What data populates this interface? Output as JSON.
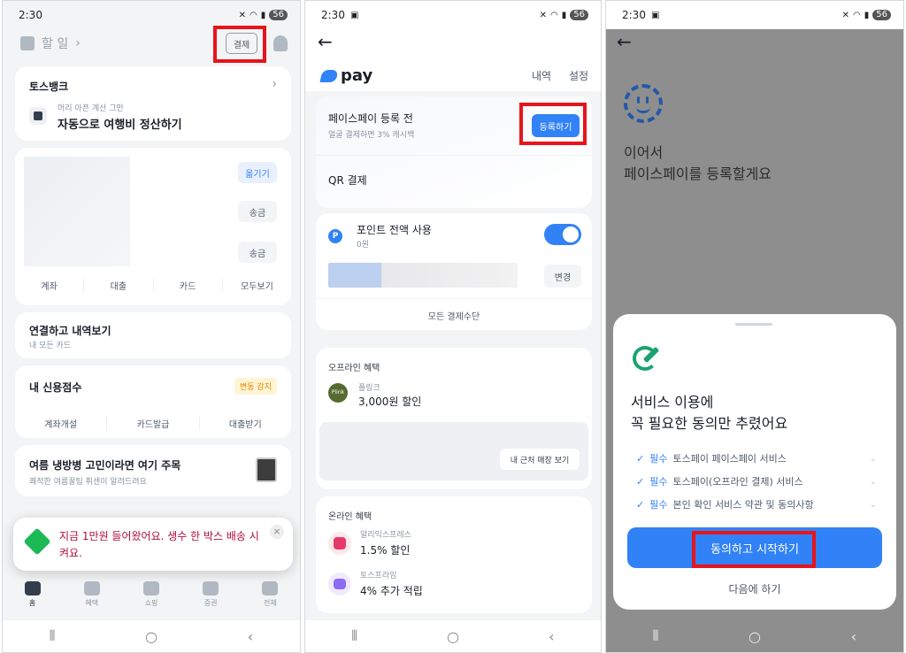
{
  "status": {
    "time": "2:30",
    "battery": "56"
  },
  "phone1": {
    "header": {
      "chip_label": "할 일",
      "chevron": "›",
      "pay_button": "결제"
    },
    "toss_bank": {
      "title": "토스뱅크",
      "chevron": "›",
      "sub": "머리 아픈 계산 그만",
      "main": "자동으로 여행비 정산하기"
    },
    "accounts": {
      "buttons": [
        "옮기기",
        "송금",
        "송금"
      ],
      "tabs": [
        "계좌",
        "대출",
        "카드",
        "모두보기"
      ]
    },
    "connect": {
      "title": "연결하고 내역보기",
      "sub": "내 모든 카드"
    },
    "credit": {
      "title": "내 신용점수",
      "badge": "변동 감지",
      "tabs": [
        "계좌개설",
        "카드발급",
        "대출받기"
      ]
    },
    "summer": {
      "title": "여름 냉방병 고민이라면 여기 주목",
      "sub": "쾌적한 여름꿀팁 휘센이 알려드려요"
    },
    "toast": {
      "text": "지금 1만원 들어왔어요. 생수 한 박스 배송 시켜요.",
      "close": "×"
    },
    "tabbar": [
      "홈",
      "혜택",
      "쇼핑",
      "증권",
      "전체"
    ]
  },
  "phone2": {
    "header": {
      "back": "←",
      "logo": "pay",
      "history": "내역",
      "settings": "설정"
    },
    "faceid": {
      "title": "페이스페이 등록 전",
      "sub": "얼굴 결제하면 3% 캐시백",
      "button": "등록하기"
    },
    "qr": {
      "title": "QR 결제"
    },
    "points": {
      "icon": "P",
      "title": "포인트 전액 사용",
      "value": "0원",
      "change": "변경",
      "all_methods": "모든 결제수단"
    },
    "offline": {
      "section": "오프라인 혜택",
      "brand": "플링크",
      "brand_icon": "Plink",
      "offer": "3,000원 할인",
      "nearby": "내 근처 매장 보기"
    },
    "online": {
      "section": "온라인 혜택",
      "items": [
        {
          "brand": "알리익스프레스",
          "offer": "1.5% 할인"
        },
        {
          "brand": "토스프라임",
          "offer": "4% 추가 적립"
        }
      ]
    }
  },
  "phone3": {
    "back": "←",
    "title_line1": "이어서",
    "title_line2": "페이스페이를 등록할게요",
    "sheet": {
      "title_line1": "서비스 이용에",
      "title_line2": "꼭 필요한 동의만 추렸어요",
      "items": [
        {
          "req": "필수",
          "text": "토스페이 페이스페이 서비스"
        },
        {
          "req": "필수",
          "text": "토스페이(오프라인 결제) 서비스"
        },
        {
          "req": "필수",
          "text": "본인 확인 서비스 약관 및 동의사항"
        }
      ],
      "agree_button": "동의하고 시작하기",
      "later": "다음에 하기"
    }
  },
  "colors": {
    "highlight": "#e8141b",
    "toss_blue": "#3182f6"
  },
  "icons": [
    "chip-icon",
    "bell-icon",
    "back-arrow-icon",
    "face-icon",
    "pen-check-icon",
    "check-icon",
    "home-icon"
  ]
}
